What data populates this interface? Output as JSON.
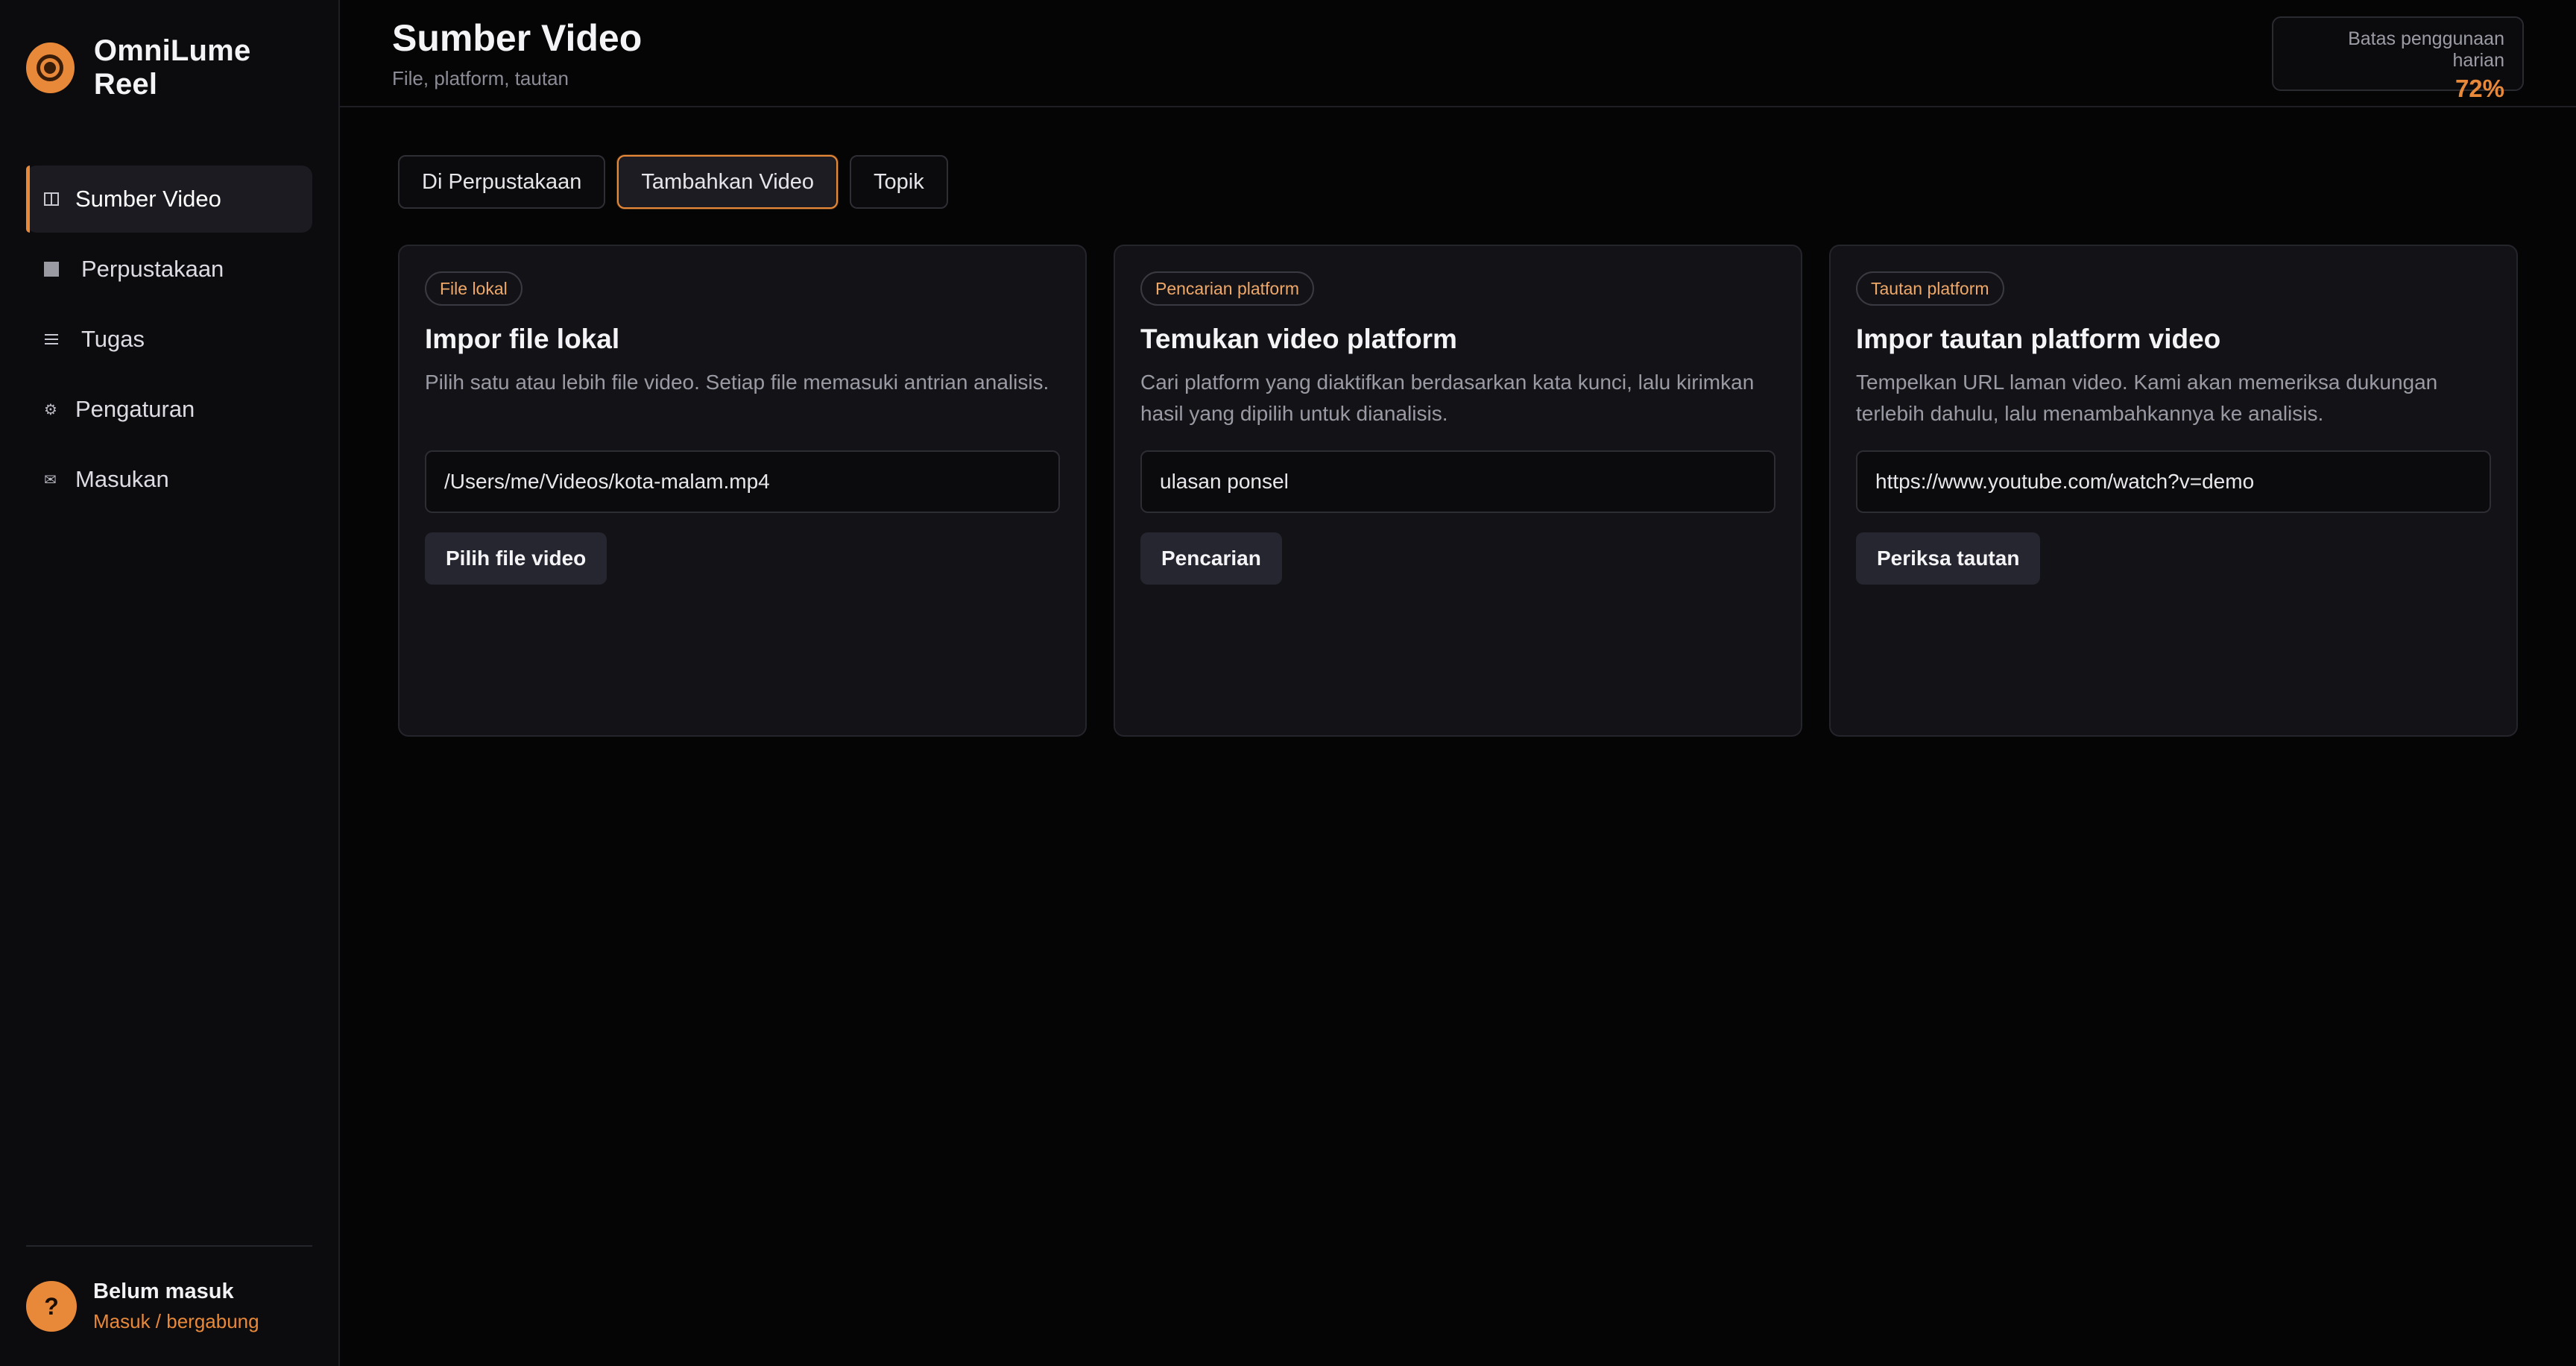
{
  "app": {
    "name": "OmniLume Reel"
  },
  "sidebar": {
    "items": [
      {
        "label": "Sumber Video",
        "icon": "columns-icon",
        "active": true
      },
      {
        "label": "Perpustakaan",
        "icon": "square-icon"
      },
      {
        "label": "Tugas",
        "icon": "list-icon"
      },
      {
        "label": "Pengaturan",
        "icon": "gear-icon"
      },
      {
        "label": "Masukan",
        "icon": "mail-icon"
      }
    ],
    "footer": {
      "avatar": "?",
      "status": "Belum masuk",
      "link": "Masuk / bergabung"
    }
  },
  "header": {
    "title": "Sumber Video",
    "subtitle": "File, platform, tautan",
    "quota": {
      "label": "Batas penggunaan harian",
      "value": "72%"
    }
  },
  "tabs": [
    {
      "label": "Di Perpustakaan"
    },
    {
      "label": "Tambahkan Video",
      "active": true
    },
    {
      "label": "Topik"
    }
  ],
  "cards": [
    {
      "badge": "File lokal",
      "title": "Impor file lokal",
      "description": "Pilih satu atau lebih file video. Setiap file memasuki antrian analisis.",
      "input_value": "/Users/me/Videos/kota-malam.mp4",
      "button": "Pilih file video"
    },
    {
      "badge": "Pencarian platform",
      "title": "Temukan video platform",
      "description": "Cari platform yang diaktifkan berdasarkan kata kunci, lalu kirimkan hasil yang dipilih untuk dianalisis.",
      "input_value": "ulasan ponsel",
      "button": "Pencarian"
    },
    {
      "badge": "Tautan platform",
      "title": "Impor tautan platform video",
      "description": "Tempelkan URL laman video. Kami akan memeriksa dukungan terlebih dahulu, lalu menambahkannya ke analisis.",
      "input_value": "https://www.youtube.com/watch?v=demo",
      "button": "Periksa tautan"
    }
  ],
  "colors": {
    "accent": "#e8893a",
    "background": "#050506",
    "sidebar": "#0c0c0f",
    "card": "#131317"
  }
}
